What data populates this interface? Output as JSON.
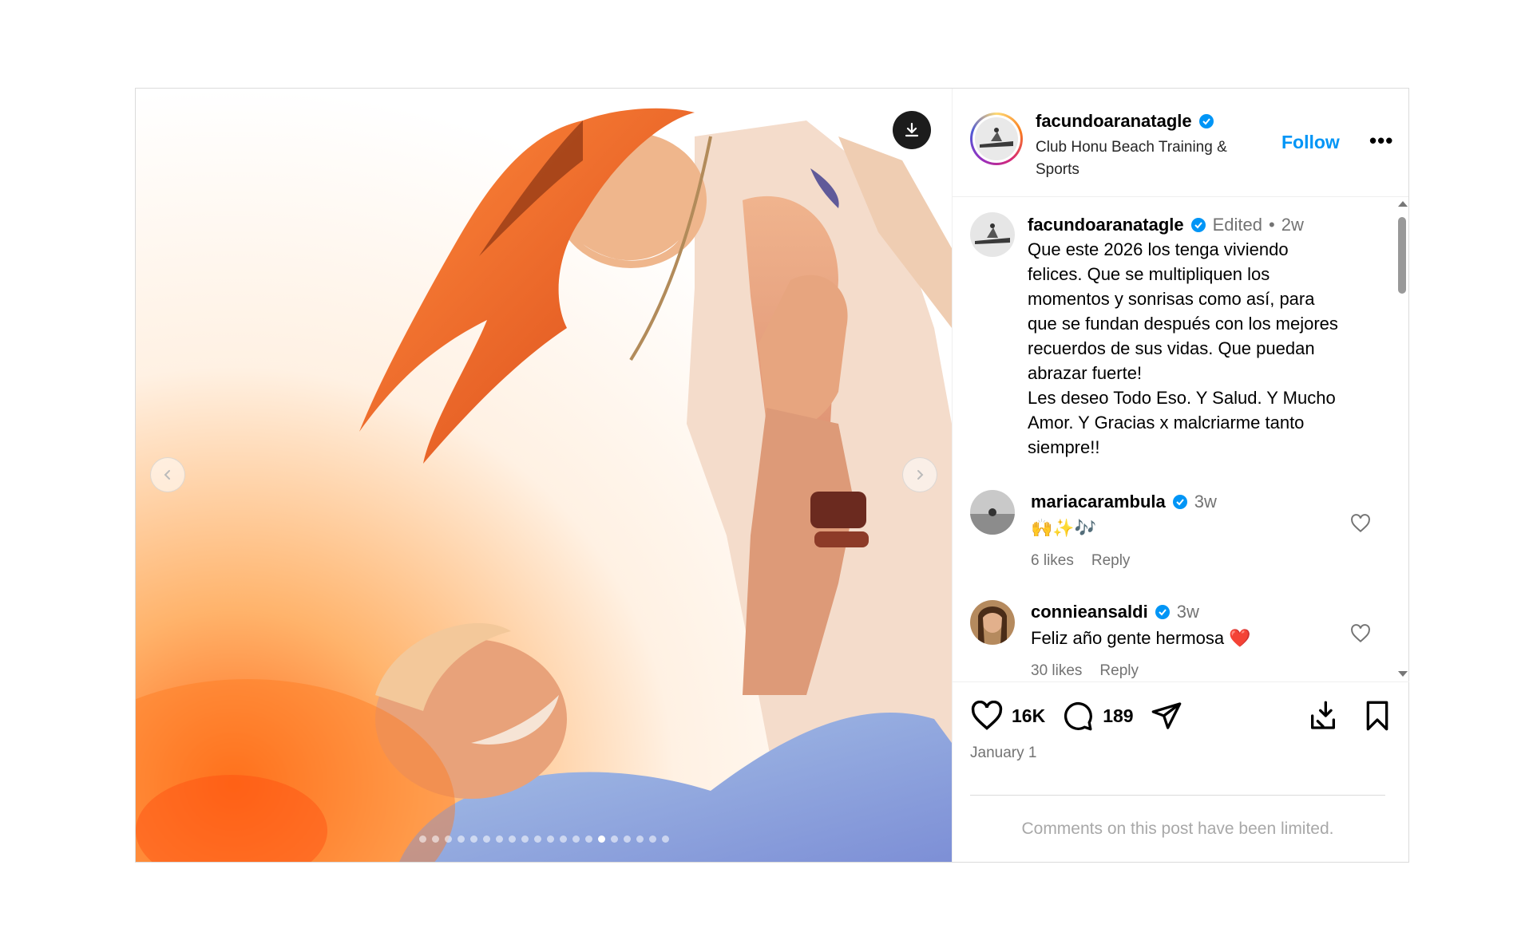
{
  "post": {
    "author": {
      "username": "facundoaranatagle",
      "verified": true,
      "subtitle": "Club Honu Beach Training & Sports",
      "follow_label": "Follow",
      "more_label": "•••"
    },
    "media": {
      "slide_count": 20,
      "active_slide_index": 14,
      "download_icon": "download-icon",
      "prev_icon": "chevron-left-icon",
      "next_icon": "chevron-right-icon"
    },
    "caption": {
      "username": "facundoaranatagle",
      "edited": "Edited",
      "separator": "•",
      "time": "2w",
      "text": "Que este 2026 los tenga viviendo\nfelices. Que se multipliquen los\nmomentos y sonrisas como así, para\nque se fundan después con los mejores\nrecuerdos de sus vidas. Que puedan\nabrazar fuerte!\n Les deseo Todo Eso. Y Salud. Y Mucho\nAmor. Y Gracias x malcriarme tanto\nsiempre!!"
    },
    "comments": [
      {
        "username": "mariacarambula",
        "verified": true,
        "time": "3w",
        "text": "🙌✨🎶",
        "likes": "6 likes",
        "reply": "Reply"
      },
      {
        "username": "connieansaldi",
        "verified": true,
        "time": "3w",
        "text": "Feliz año gente hermosa ❤️",
        "likes": "30 likes",
        "reply": "Reply"
      }
    ],
    "actions": {
      "like_count": "16K",
      "comment_count": "189",
      "date": "January 1"
    },
    "limited_notice": "Comments on this post have been limited.",
    "colors": {
      "accent": "#0095f6",
      "secondary_text": "#737373",
      "heart_red": "#e0102a"
    }
  }
}
